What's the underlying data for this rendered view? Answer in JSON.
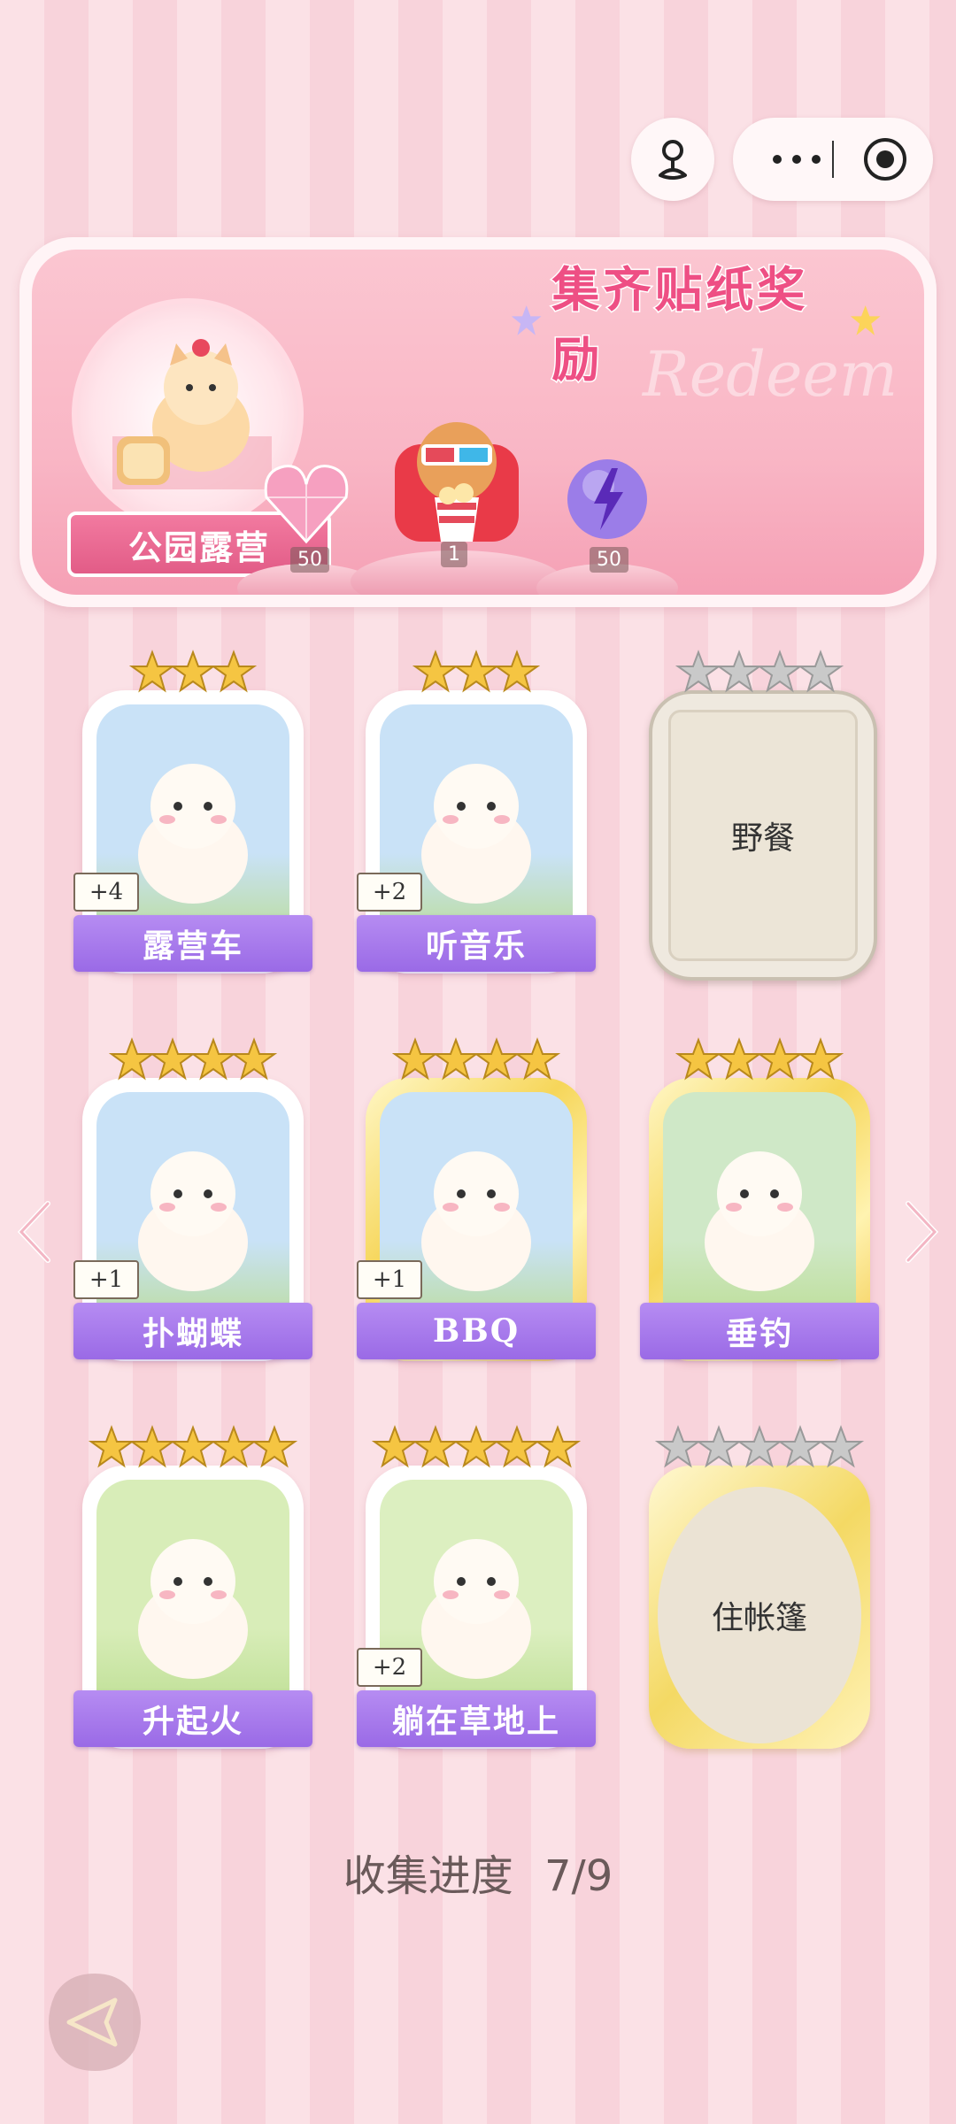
{
  "capsule": {
    "more_icon": "more-dots-icon",
    "target_icon": "record-target-icon",
    "profile_icon": "joystick-icon"
  },
  "banner": {
    "title": "集齐贴纸奖励",
    "ghost_text": "Redeem",
    "scene_label": "公园露营"
  },
  "rewards": [
    {
      "icon": "heart-gem-icon",
      "count": "50"
    },
    {
      "icon": "bear-popcorn-icon",
      "count": "1"
    },
    {
      "icon": "lightning-orb-icon",
      "count": "50"
    }
  ],
  "cards": [
    {
      "label": "露营车",
      "plus": "+4",
      "stars": 3,
      "state": "collected"
    },
    {
      "label": "听音乐",
      "plus": "+2",
      "stars": 3,
      "state": "collected"
    },
    {
      "label": "野餐",
      "plus": "",
      "stars": 4,
      "state": "locked"
    },
    {
      "label": "扑蝴蝶",
      "plus": "+1",
      "stars": 4,
      "state": "collected"
    },
    {
      "label": "BBQ",
      "plus": "+1",
      "stars": 4,
      "state": "collected-gold"
    },
    {
      "label": "垂钓",
      "plus": "",
      "stars": 4,
      "state": "collected-gold"
    },
    {
      "label": "升起火",
      "plus": "",
      "stars": 5,
      "state": "collected"
    },
    {
      "label": "躺在草地上",
      "plus": "+2",
      "stars": 5,
      "state": "collected"
    },
    {
      "label": "住帐篷",
      "plus": "",
      "stars": 5,
      "state": "locked-gold"
    }
  ],
  "progress": {
    "label": "收集进度",
    "value": "7/9"
  },
  "colors": {
    "accent": "#ee4f84",
    "ribbon": "#a77aed",
    "star_gold": "#f5c542",
    "star_gray": "#c9c9c9"
  }
}
